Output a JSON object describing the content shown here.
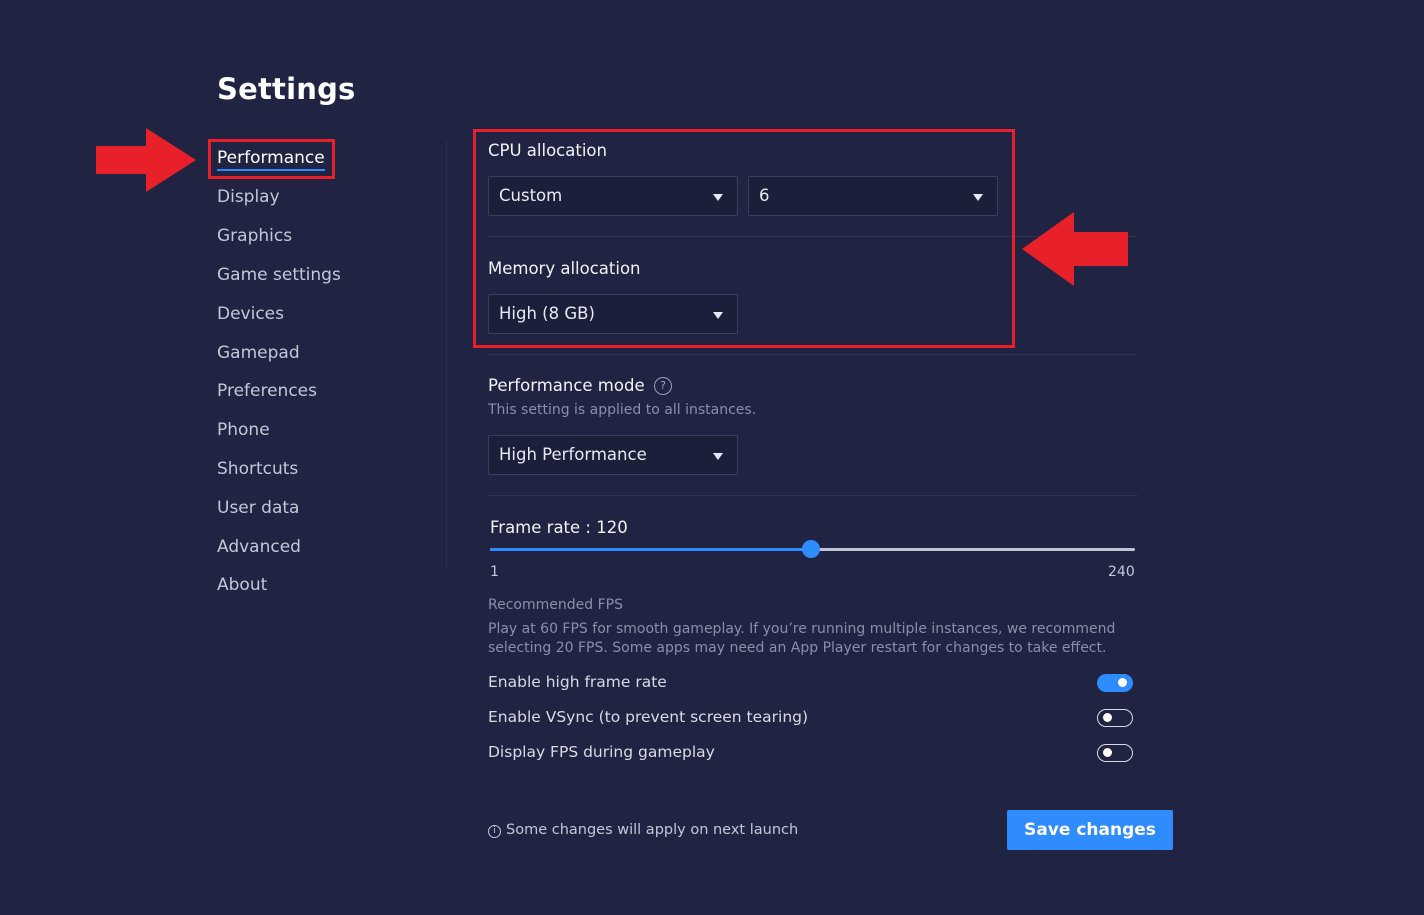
{
  "header": {
    "title": "Settings"
  },
  "sidebar": {
    "items": [
      {
        "label": "Performance",
        "active": true
      },
      {
        "label": "Display"
      },
      {
        "label": "Graphics"
      },
      {
        "label": "Game settings"
      },
      {
        "label": "Devices"
      },
      {
        "label": "Gamepad"
      },
      {
        "label": "Preferences"
      },
      {
        "label": "Phone"
      },
      {
        "label": "Shortcuts"
      },
      {
        "label": "User data"
      },
      {
        "label": "Advanced"
      },
      {
        "label": "About"
      }
    ]
  },
  "cpu": {
    "label": "CPU allocation",
    "mode": "Custom",
    "cores": "6"
  },
  "memory": {
    "label": "Memory allocation",
    "value": "High (8 GB)"
  },
  "performance_mode": {
    "label": "Performance mode",
    "help_glyph": "?",
    "subtext": "This setting is applied to all instances.",
    "value": "High Performance"
  },
  "frame_rate": {
    "label": "Frame rate : 120",
    "value": 120,
    "min": 1,
    "max": 240,
    "min_label": "1",
    "max_label": "240"
  },
  "recommended": {
    "title": "Recommended FPS",
    "text": "Play at 60 FPS for smooth gameplay. If you’re running multiple instances, we recommend selecting 20 FPS. Some apps may need an App Player restart for changes to take effect."
  },
  "toggles": [
    {
      "label": "Enable high frame rate",
      "on": true
    },
    {
      "label": "Enable VSync (to prevent screen tearing)",
      "on": false
    },
    {
      "label": "Display FPS during gameplay",
      "on": false
    }
  ],
  "footer": {
    "info_glyph": "i",
    "note": "Some changes will apply on next launch",
    "save_label": "Save changes"
  },
  "colors": {
    "background": "#202442",
    "accent": "#2f8cff",
    "annotation_red": "#e8202a"
  }
}
